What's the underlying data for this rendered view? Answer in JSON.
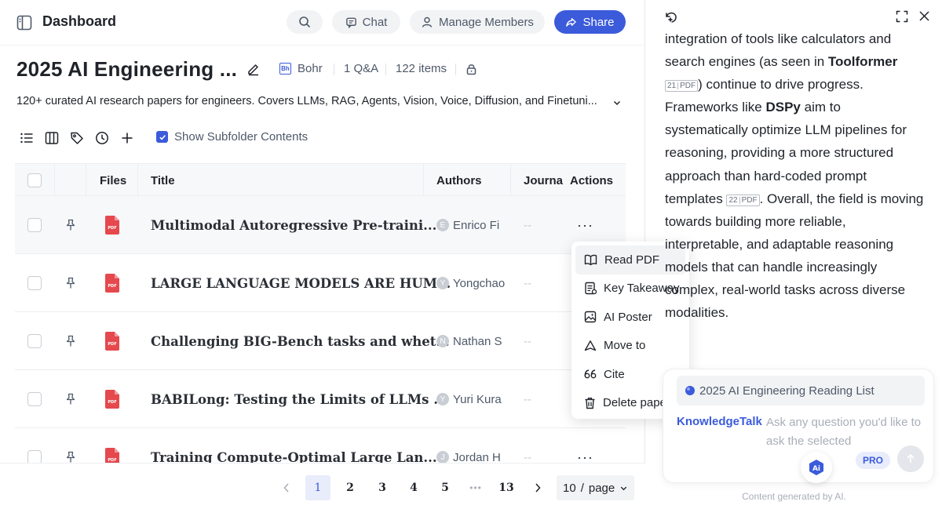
{
  "header": {
    "title": "Dashboard",
    "chat_label": "Chat",
    "members_label": "Manage Members",
    "share_label": "Share"
  },
  "collection": {
    "title": "2025 AI Engineering ...",
    "owner": "Bohr",
    "owner_logo": "Bh",
    "qa": "1 Q&A",
    "items": "122 items",
    "description": "120+ curated AI research papers for engineers. Covers LLMs, RAG, Agents, Vision, Voice, Diffusion, and Finetuni..."
  },
  "toolbar": {
    "show_subfolder": "Show Subfolder Contents",
    "show_subfolder_checked": true
  },
  "table": {
    "headers": {
      "files": "Files",
      "title": "Title",
      "authors": "Authors",
      "journal": "Journa",
      "actions": "Actions"
    },
    "rows": [
      {
        "title": "Multimodal Autoregressive Pre-traini...",
        "author_initial": "E",
        "author": "Enrico Fi",
        "journal": "--",
        "actions": "···"
      },
      {
        "title": "LARGE LANGUAGE MODELS ARE HUM...",
        "author_initial": "Y",
        "author": "Yongchao",
        "journal": "--",
        "actions": ""
      },
      {
        "title": "Challenging BIG-Bench tasks and whet...",
        "author_initial": "N",
        "author": "Nathan S",
        "journal": "--",
        "actions": ""
      },
      {
        "title": "BABILong: Testing the Limits of LLMs ...",
        "author_initial": "Y",
        "author": "Yuri Kura",
        "journal": "--",
        "actions": ""
      },
      {
        "title": "Training Compute-Optimal Large Lan...",
        "author_initial": "J",
        "author": "Jordan H",
        "journal": "--",
        "actions": "···"
      }
    ]
  },
  "pagination": {
    "pages": [
      "1",
      "2",
      "3",
      "4",
      "5"
    ],
    "ellipsis": "•••",
    "last": "13",
    "size_value": "10",
    "size_sep": "/",
    "size_unit": "page"
  },
  "menu": {
    "items": [
      "Read PDF",
      "Key Takeaway",
      "AI Poster",
      "Move to",
      "Cite",
      "Delete paper"
    ]
  },
  "article": {
    "p1": "integration of tools like calculators and search engines (as seen in ",
    "toolformer": "Toolformer",
    "cite1_num": "21",
    "cite1_tag": "PDF",
    "p2": ") continue to drive progress. Frameworks like ",
    "dspy": "DSPy",
    "p3": " aim to systematically optimize LLM pipelines for reasoning, providing a more structured approach than hard-coded prompt templates ",
    "cite2_num": "22",
    "cite2_tag": "PDF",
    "p4": ". Overall, the field is moving towards building more reliable, interpretable, and adaptable reasoning models that can handle increasingly complex, real-world tasks across diverse modalities."
  },
  "chat": {
    "context": "2025 AI Engineering Reading List",
    "mode": "KnowledgeTalk",
    "placeholder": "Ask any question you'd like to ask the selected",
    "ai_label": "Ai",
    "pro": "PRO",
    "footer": "Content generated by AI."
  },
  "colors": {
    "accent": "#3b5bdb",
    "pdf_red": "#e5484d"
  }
}
